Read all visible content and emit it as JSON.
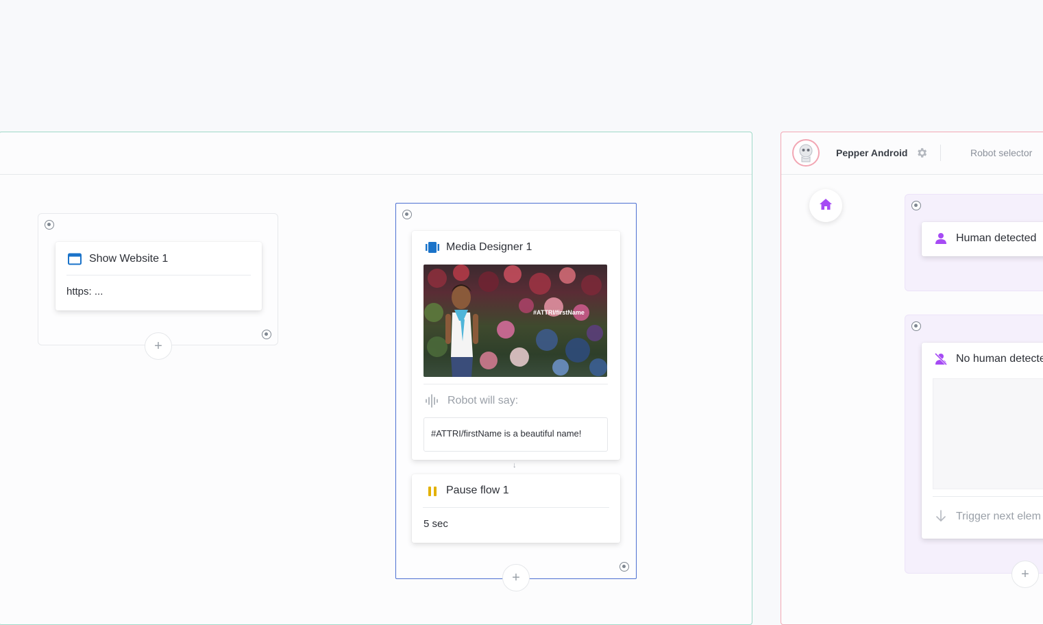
{
  "canvas": {
    "connector_color": "#c9ccd1",
    "accent_blue": "#1a73c9",
    "accent_purple": "#a64bf4",
    "accent_yellow": "#e2b100"
  },
  "robot_panel": {
    "robot_name": "Pepper Android",
    "selector_label": "Robot selector",
    "avatar_icon": "robot-avatar-icon",
    "settings_icon": "gear-icon"
  },
  "show_website": {
    "title": "Show Website 1",
    "url_text": "https:  ...",
    "icon": "browser-window-icon"
  },
  "media_designer": {
    "title": "Media Designer 1",
    "icon": "media-designer-icon",
    "image_overlay_text": "#ATTRI/firstName",
    "robot_will_say_label": "Robot will say:",
    "speech_text": "#ATTRI/firstName is a beautiful name!",
    "arrow": "↓"
  },
  "pause_flow": {
    "title": "Pause flow 1",
    "duration": "5 sec",
    "icon": "pause-icon"
  },
  "triggers": {
    "human_detected": "Human detected",
    "no_human_detected": "No human detecte",
    "trigger_next": "Trigger next elem"
  },
  "buttons": {
    "add": "+"
  }
}
